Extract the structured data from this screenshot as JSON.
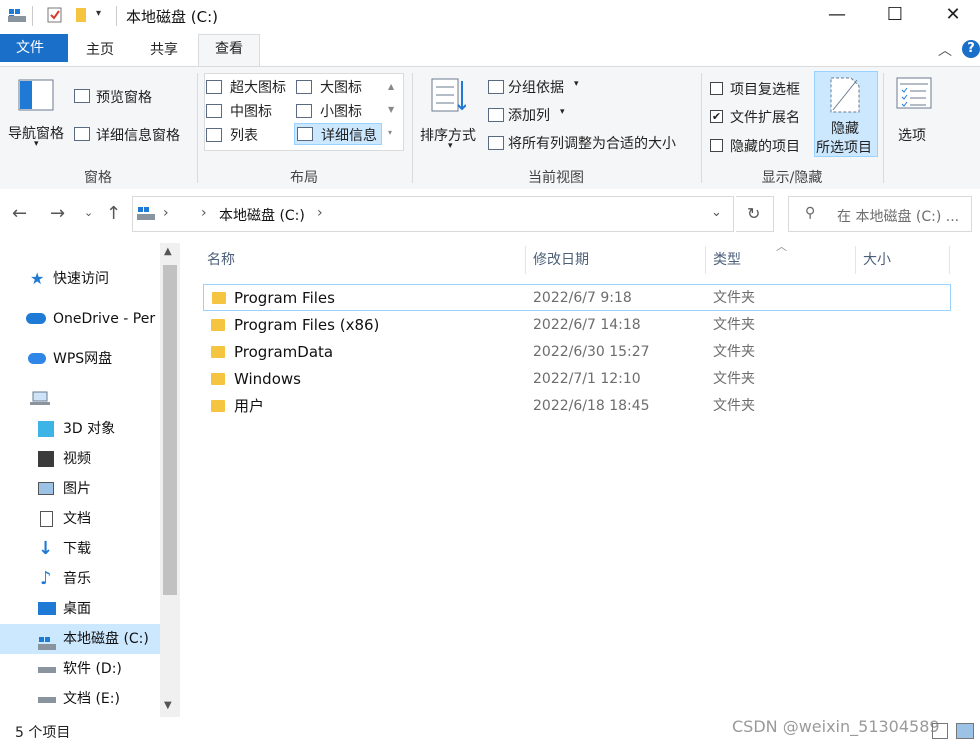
{
  "window": {
    "title": "本地磁盘 (C:)"
  },
  "tabs": [
    {
      "label": "文件"
    },
    {
      "label": "主页"
    },
    {
      "label": "共享"
    },
    {
      "label": "查看"
    }
  ],
  "ribbon": {
    "pane": {
      "nav_pane": "导航窗格",
      "preview_pane": "预览窗格",
      "details_pane": "详细信息窗格",
      "label": "窗格"
    },
    "layout": {
      "extra_large": "超大图标",
      "large": "大图标",
      "medium": "中图标",
      "small": "小图标",
      "list": "列表",
      "details": "详细信息",
      "label": "布局"
    },
    "current_view": {
      "sort_by": "排序方式",
      "group_by": "分组依据",
      "add_columns": "添加列",
      "size_all_columns": "将所有列调整为合适的大小",
      "label": "当前视图"
    },
    "show_hide": {
      "item_checkboxes": "项目复选框",
      "item_checkboxes_checked": false,
      "file_extensions": "文件扩展名",
      "file_extensions_checked": true,
      "hidden_items": "隐藏的项目",
      "hidden_items_checked": false,
      "hide_selected_line1": "隐藏",
      "hide_selected_line2": "所选项目",
      "label": "显示/隐藏"
    },
    "options": "选项"
  },
  "address": {
    "path_segment": "本地磁盘 (C:)",
    "search_placeholder": "在 本地磁盘 (C:) ..."
  },
  "nav": {
    "quick_access": "快速访问",
    "onedrive": "OneDrive - Per",
    "wps": "WPS网盘",
    "objects3d": "3D 对象",
    "videos": "视频",
    "pictures": "图片",
    "documents": "文档",
    "downloads": "下载",
    "music": "音乐",
    "desktop": "桌面",
    "local_c": "本地磁盘 (C:)",
    "software_d": "软件 (D:)",
    "docs_e": "文档 (E:)"
  },
  "columns": {
    "name": "名称",
    "modified": "修改日期",
    "type": "类型",
    "size": "大小"
  },
  "files": [
    {
      "name": "Program Files",
      "modified": "2022/6/7 9:18",
      "type": "文件夹"
    },
    {
      "name": "Program Files (x86)",
      "modified": "2022/6/7 14:18",
      "type": "文件夹"
    },
    {
      "name": "ProgramData",
      "modified": "2022/6/30 15:27",
      "type": "文件夹"
    },
    {
      "name": "Windows",
      "modified": "2022/7/1 12:10",
      "type": "文件夹"
    },
    {
      "name": "用户",
      "modified": "2022/6/18 18:45",
      "type": "文件夹"
    }
  ],
  "status": {
    "item_count": "5 个项目"
  },
  "watermark": "CSDN @weixin_51304589",
  "colors": {
    "accent": "#1a6fc9",
    "selection": "#cce8ff",
    "folder": "#f5c542"
  }
}
